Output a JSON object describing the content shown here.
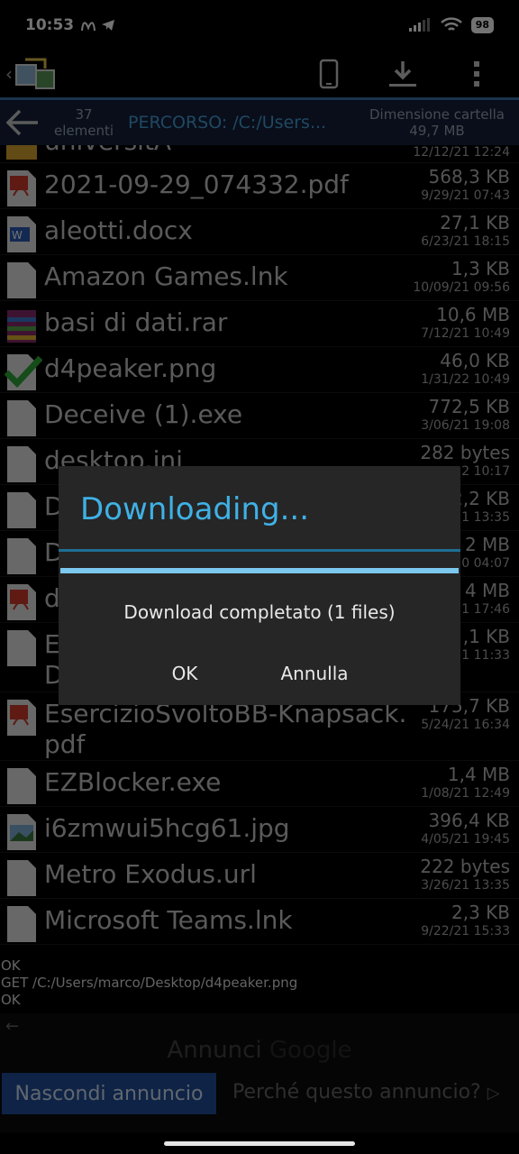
{
  "status": {
    "time": "10:53",
    "battery": "98"
  },
  "pathbar": {
    "count": "37",
    "count_label": "elementi",
    "path": "PERCORSO: /C:/Users...",
    "size_label": "Dimensione cartella",
    "size_value": "49,7 MB"
  },
  "files": [
    {
      "name": "universitA",
      "size": "",
      "date": "12/12/21 12:24",
      "icon": "folder-icon"
    },
    {
      "name": "2021-09-29_074332.pdf",
      "size": "568,3 KB",
      "date": "9/29/21 07:43",
      "icon": "pdf-file-icon"
    },
    {
      "name": "aleotti.docx",
      "size": "27,1 KB",
      "date": "6/23/21 18:15",
      "icon": "word-file-icon"
    },
    {
      "name": "Amazon Games.lnk",
      "size": "1,3 KB",
      "date": "10/09/21 09:56",
      "icon": "generic-file-icon"
    },
    {
      "name": "basi di dati.rar",
      "size": "10,6 MB",
      "date": "7/12/21 10:49",
      "icon": "archive-file-icon"
    },
    {
      "name": "d4peaker.png",
      "size": "46,0 KB",
      "date": "1/31/22 10:49",
      "icon": "checked-file-icon"
    },
    {
      "name": "Deceive (1).exe",
      "size": "772,5 KB",
      "date": "3/06/21 19:08",
      "icon": "generic-file-icon"
    },
    {
      "name": "desktop.ini",
      "size": "282 bytes",
      "date": "2 10:17",
      "icon": "generic-file-icon"
    },
    {
      "name": "D",
      "size": "2,2 KB",
      "date": "1 13:35",
      "icon": "generic-file-icon"
    },
    {
      "name": "D",
      "size": "2 MB",
      "date": "0 04:07",
      "icon": "generic-file-icon"
    },
    {
      "name": "d",
      "size": "4 MB",
      "date": "1 17:46",
      "icon": "pdf-file-icon"
    },
    {
      "name": "E",
      "name2": "D",
      "size": ",1 KB",
      "date": "1 11:33",
      "icon": "generic-file-icon"
    },
    {
      "name": "EsercizioSvoltoBB-Knapsack.",
      "name2": "pdf",
      "size": "175,7 KB",
      "date": "5/24/21 16:34",
      "icon": "pdf-file-icon"
    },
    {
      "name": "EZBlocker.exe",
      "size": "1,4 MB",
      "date": "1/08/21 12:49",
      "icon": "generic-file-icon"
    },
    {
      "name": "i6zmwui5hcg61.jpg",
      "size": "396,4 KB",
      "date": "4/05/21 19:45",
      "icon": "image-file-icon"
    },
    {
      "name": "Metro Exodus.url",
      "size": "222 bytes",
      "date": "3/26/21 13:35",
      "icon": "generic-file-icon"
    },
    {
      "name": "Microsoft Teams.lnk",
      "size": "2,3 KB",
      "date": "9/22/21 15:33",
      "icon": "generic-file-icon"
    }
  ],
  "log": {
    "line1": "OK",
    "line2": "GET /C:/Users/marco/Desktop/d4peaker.png",
    "line3": "OK"
  },
  "ad": {
    "label": "Annunci",
    "brand": "Google",
    "hide_label": "Nascondi annuncio",
    "why_label": "Perché questo annuncio?"
  },
  "dialog": {
    "title": "Downloading...",
    "progress": 1.0,
    "message": "Download completato (1 files)",
    "ok_label": "OK",
    "cancel_label": "Annulla"
  },
  "colors": {
    "accent": "#3fb1e5",
    "path": "#46a0d9",
    "ad_button": "#1f4f9a"
  }
}
